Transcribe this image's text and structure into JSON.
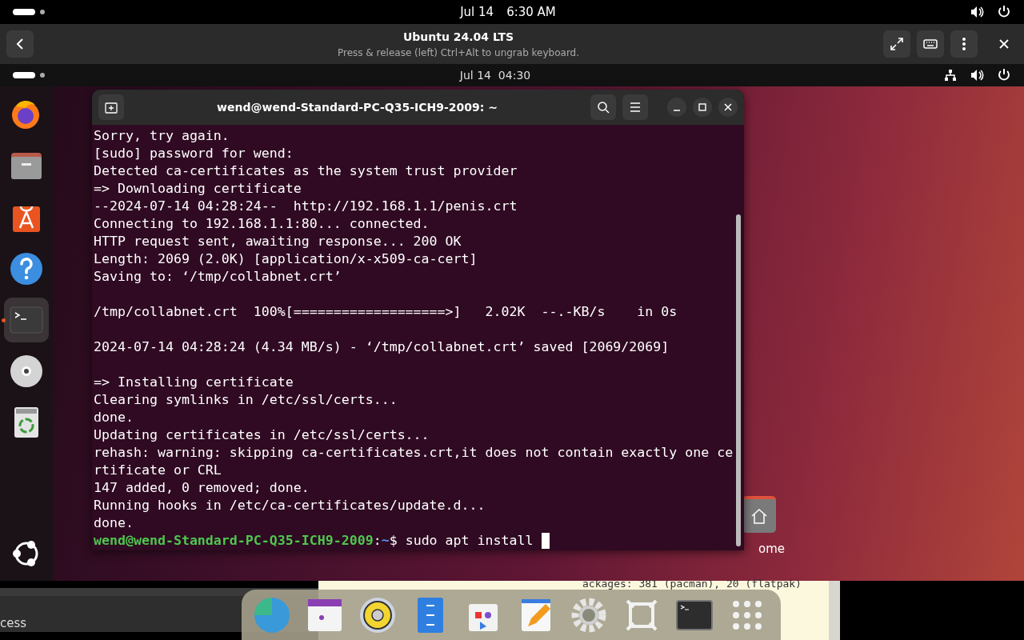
{
  "host_bar": {
    "date": "Jul 14",
    "time": "6:30 AM"
  },
  "vm_header": {
    "title": "Ubuntu 24.04 LTS",
    "subtitle": "Press & release (left) Ctrl+Alt to ungrab keyboard."
  },
  "guest_bar": {
    "datetime": "Jul 14  04:30"
  },
  "dock": {
    "items": [
      {
        "kind": "firefox",
        "selected": false
      },
      {
        "kind": "files",
        "selected": false
      },
      {
        "kind": "store",
        "selected": false
      },
      {
        "kind": "help",
        "selected": false
      },
      {
        "kind": "terminal",
        "selected": true
      },
      {
        "kind": "disc",
        "selected": false
      },
      {
        "kind": "trash",
        "selected": false
      }
    ]
  },
  "terminal": {
    "title": "wend@wend-Standard-PC-Q35-ICH9-2009: ~",
    "lines": [
      {
        "kind": "text",
        "text": "Sorry, try again."
      },
      {
        "kind": "text",
        "text": "[sudo] password for wend:"
      },
      {
        "kind": "text",
        "text": "Detected ca-certificates as the system trust provider"
      },
      {
        "kind": "text",
        "text": "=> Downloading certificate"
      },
      {
        "kind": "text",
        "text": "--2024-07-14 04:28:24--  http://192.168.1.1/penis.crt"
      },
      {
        "kind": "text",
        "text": "Connecting to 192.168.1.1:80... connected."
      },
      {
        "kind": "text",
        "text": "HTTP request sent, awaiting response... 200 OK"
      },
      {
        "kind": "text",
        "text": "Length: 2069 (2.0K) [application/x-x509-ca-cert]"
      },
      {
        "kind": "text",
        "text": "Saving to: ‘/tmp/collabnet.crt’"
      },
      {
        "kind": "blank"
      },
      {
        "kind": "text",
        "text": "/tmp/collabnet.crt  100%[===================>]   2.02K  --.-KB/s    in 0s"
      },
      {
        "kind": "blank"
      },
      {
        "kind": "text",
        "text": "2024-07-14 04:28:24 (4.34 MB/s) - ‘/tmp/collabnet.crt’ saved [2069/2069]"
      },
      {
        "kind": "blank"
      },
      {
        "kind": "text",
        "text": "=> Installing certificate"
      },
      {
        "kind": "text",
        "text": "Clearing symlinks in /etc/ssl/certs..."
      },
      {
        "kind": "text",
        "text": "done."
      },
      {
        "kind": "text",
        "text": "Updating certificates in /etc/ssl/certs..."
      },
      {
        "kind": "text",
        "text": "rehash: warning: skipping ca-certificates.crt,it does not contain exactly one ce"
      },
      {
        "kind": "text",
        "text": "rtificate or CRL"
      },
      {
        "kind": "text",
        "text": "147 added, 0 removed; done."
      },
      {
        "kind": "text",
        "text": "Running hooks in /etc/ca-certificates/update.d..."
      },
      {
        "kind": "text",
        "text": "done."
      }
    ],
    "prompt": {
      "user": "wend@wend-Standard-PC-Q35-ICH9-2009",
      "separator": ":",
      "path": "~",
      "symbol": "$",
      "command": "sudo apt install"
    }
  },
  "desktop_icon": {
    "label": "ome"
  },
  "background_window": {
    "text": "cess"
  },
  "neofetch": {
    "line": "ackages: 381 (pacman), 20 (flatpak)"
  },
  "taskbar": {
    "items": [
      {
        "kind": "globe"
      },
      {
        "kind": "calendar"
      },
      {
        "kind": "speaker"
      },
      {
        "kind": "cabinet"
      },
      {
        "kind": "bag"
      },
      {
        "kind": "editor"
      },
      {
        "kind": "gear"
      },
      {
        "kind": "frame"
      },
      {
        "kind": "terminal"
      },
      {
        "kind": "grid"
      }
    ]
  }
}
